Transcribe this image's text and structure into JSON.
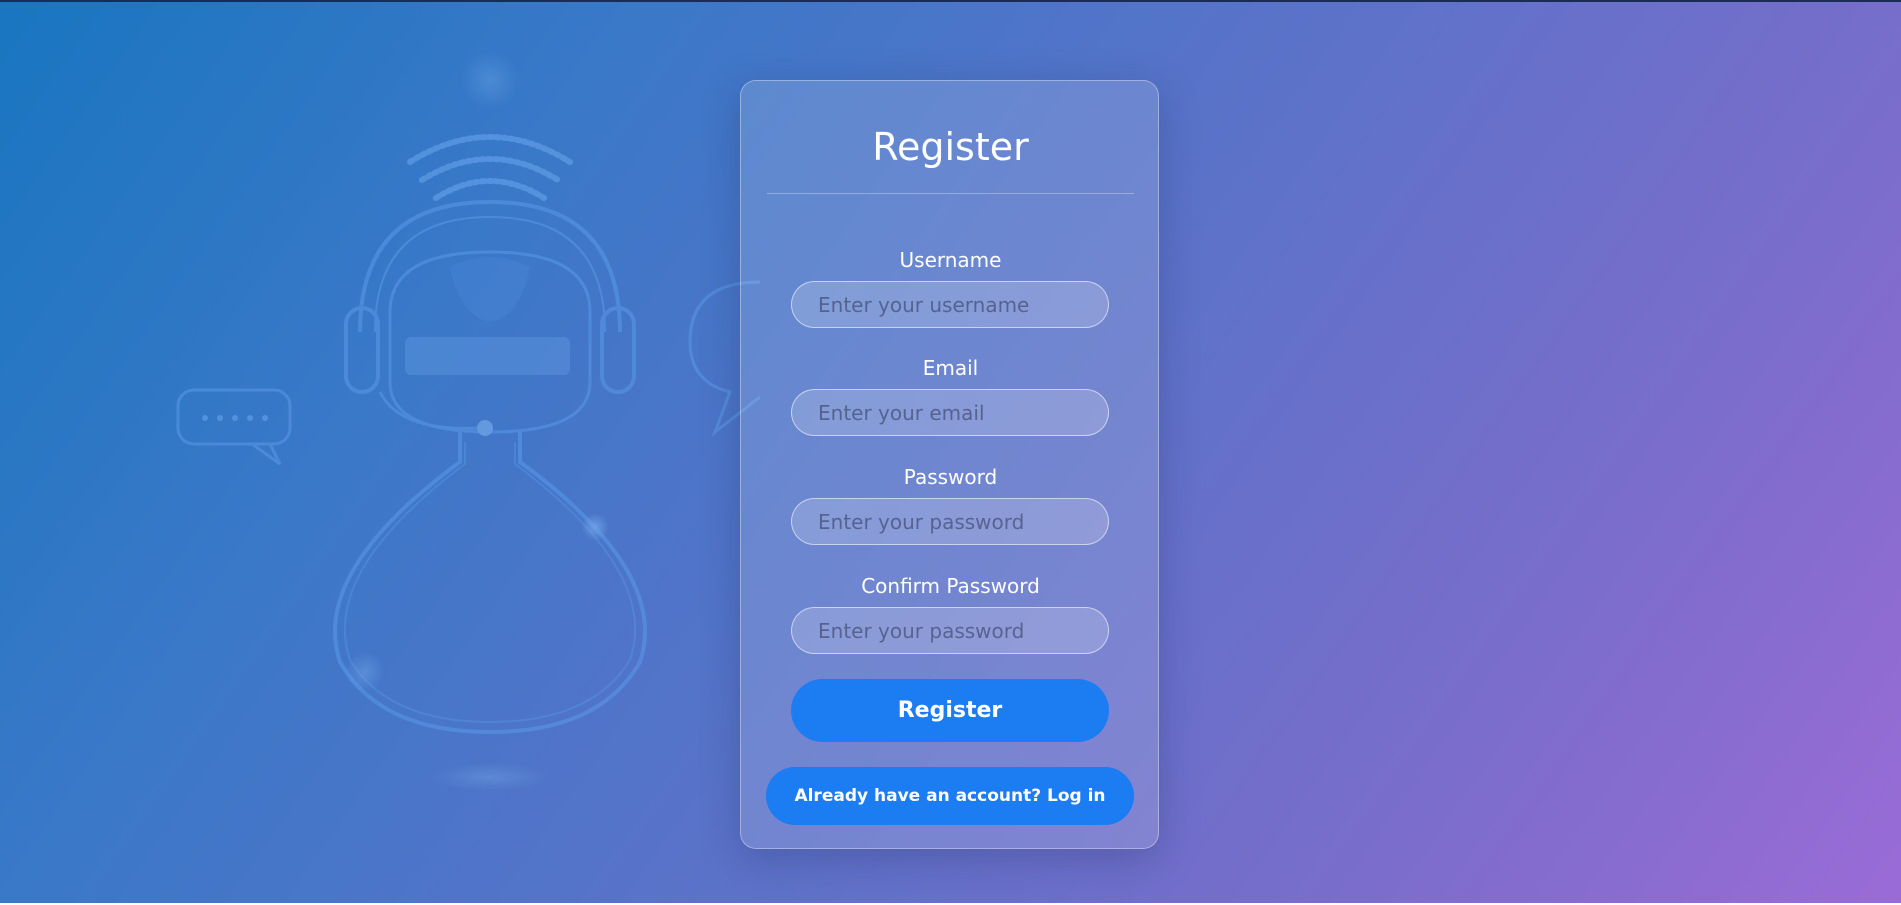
{
  "form": {
    "title": "Register",
    "fields": [
      {
        "label": "Username",
        "placeholder": "Enter your username",
        "value": ""
      },
      {
        "label": "Email",
        "placeholder": "Enter your email",
        "value": ""
      },
      {
        "label": "Password",
        "placeholder": "Enter your password",
        "value": ""
      },
      {
        "label": "Confirm Password",
        "placeholder": "Enter your password",
        "value": ""
      }
    ],
    "submit_label": "Register",
    "login_link_label": "Already have an account? Log in"
  },
  "colors": {
    "button": "#1c7cf2",
    "gradient_start": "#1976c0",
    "gradient_end": "#9a6bd6"
  },
  "icons": [
    "support-agent-illustration",
    "chat-bubble-icon",
    "wifi-signal-icon"
  ]
}
